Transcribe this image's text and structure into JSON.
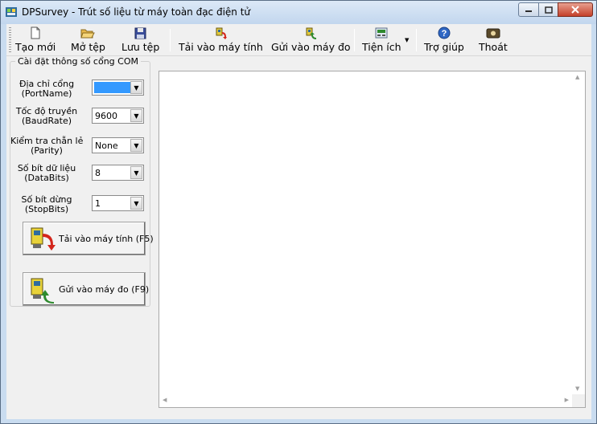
{
  "window": {
    "title": "DPSurvey - Trút số liệu từ máy toàn đạc điện tử"
  },
  "toolbar": {
    "buttons": [
      {
        "label": "Tạo mới",
        "icon": "new-file-icon"
      },
      {
        "label": "Mở tệp",
        "icon": "open-folder-icon"
      },
      {
        "label": "Lưu tệp",
        "icon": "save-disk-icon"
      },
      {
        "label": "Tải vào máy tính",
        "icon": "download-to-pc-icon"
      },
      {
        "label": "Gửi vào máy đo",
        "icon": "upload-to-device-icon"
      },
      {
        "label": "Tiện ích",
        "icon": "utilities-icon"
      },
      {
        "label": "Trợ giúp",
        "icon": "help-icon"
      },
      {
        "label": "Thoát",
        "icon": "exit-icon"
      }
    ]
  },
  "com_settings": {
    "group_title": "Cài đặt thông số cổng COM",
    "fields": [
      {
        "label_line1": "Địa chỉ cổng",
        "label_line2": "(PortName)",
        "value": ""
      },
      {
        "label_line1": "Tốc độ truyền",
        "label_line2": "(BaudRate)",
        "value": "9600"
      },
      {
        "label_line1": "Kiểm tra chẵn lẻ",
        "label_line2": "(Parity)",
        "value": "None"
      },
      {
        "label_line1": "Số bít dữ liệu",
        "label_line2": "(DataBits)",
        "value": "8"
      },
      {
        "label_line1": "Số bít dừng",
        "label_line2": "(StopBits)",
        "value": "1"
      }
    ],
    "download_button": "Tải vào máy tính (F5)",
    "send_button": "Gửi vào máy đo (F9)"
  },
  "colors": {
    "selection": "#3399ff",
    "title_gradient_top": "#dce9f7",
    "close_red": "#c4402a"
  }
}
